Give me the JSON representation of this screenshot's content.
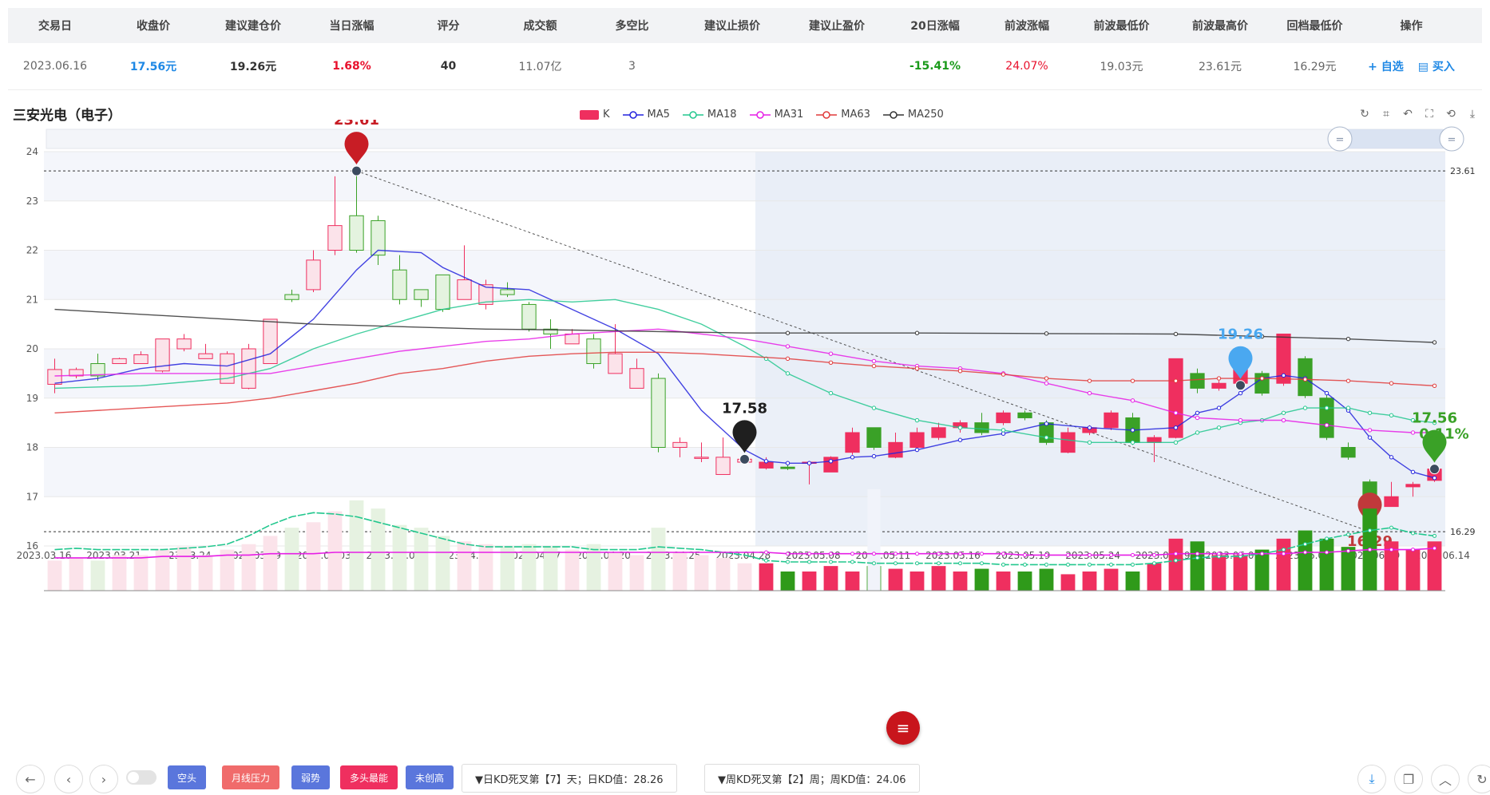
{
  "table": {
    "headers": [
      "交易日",
      "收盘价",
      "建议建仓价",
      "当日涨幅",
      "评分",
      "成交额",
      "多空比",
      "建议止损价",
      "建议止盈价",
      "20日涨幅",
      "前波涨幅",
      "前波最低价",
      "前波最高价",
      "回档最低价",
      "操作"
    ],
    "row": [
      "2023.06.16",
      "17.56元",
      "19.26元",
      "1.68%",
      "40",
      "11.07亿",
      "3",
      "",
      "",
      "-15.41%",
      "24.07%",
      "19.03元",
      "23.61元",
      "16.29元"
    ],
    "row_colors": [
      "#666",
      "#1e88e5",
      "#333",
      "#e8112d",
      "#333",
      "#666",
      "#666",
      "#333",
      "#333",
      "#1a9a1a",
      "#e8112d",
      "#666",
      "#666",
      "#666"
    ],
    "row_bold": [
      false,
      true,
      true,
      true,
      true,
      false,
      false,
      false,
      false,
      true,
      false,
      false,
      false,
      false
    ],
    "action_watch": "+ 自选",
    "action_buy": "买入"
  },
  "chart_title": "三安光电（电子）",
  "legend": [
    {
      "name": "K",
      "color": "#ef2f5f"
    },
    {
      "name": "MA5",
      "color": "#2222dd"
    },
    {
      "name": "MA18",
      "color": "#22c78e"
    },
    {
      "name": "MA31",
      "color": "#e61ee6"
    },
    {
      "name": "MA63",
      "color": "#e03a3a"
    },
    {
      "name": "MA250",
      "color": "#333333"
    }
  ],
  "tool_icons": [
    "refresh-icon",
    "crop-icon",
    "undo-crop-icon",
    "fullscreen-icon",
    "reset-icon",
    "download-icon"
  ],
  "chart_data": {
    "type": "candlestick",
    "ylim": [
      16,
      24
    ],
    "yticks": [
      16,
      17,
      18,
      19,
      20,
      21,
      22,
      23,
      24
    ],
    "xticks": [
      "2023.03.16",
      "2023.03.21",
      "2023.03.24",
      "2023.03.29",
      "2023.04.03",
      "2023.04.07",
      "2023.04.12",
      "2023.04.17",
      "2023.04.20",
      "2023.04.25",
      "2023.04.28",
      "2023.05.08",
      "2023.05.11",
      "2023.05.16",
      "2023.05.19",
      "2023.05.24",
      "2023.05.29",
      "2023.06.01",
      "2023.06.06",
      "2023.06.09",
      "2023.06.14"
    ],
    "candles": [
      [
        19.28,
        19.58,
        19.1,
        19.8
      ],
      [
        19.45,
        19.58,
        19.4,
        19.62
      ],
      [
        19.7,
        19.45,
        19.35,
        19.9
      ],
      [
        19.7,
        19.8,
        19.7,
        19.82
      ],
      [
        19.7,
        19.88,
        19.7,
        19.95
      ],
      [
        19.55,
        20.2,
        19.52,
        20.2
      ],
      [
        20.0,
        20.2,
        19.95,
        20.3
      ],
      [
        19.8,
        19.9,
        19.8,
        20.1
      ],
      [
        19.3,
        19.9,
        19.3,
        19.95
      ],
      [
        19.2,
        20.0,
        19.18,
        20.1
      ],
      [
        19.7,
        20.6,
        19.7,
        20.6
      ],
      [
        21.1,
        21.0,
        20.95,
        21.2
      ],
      [
        21.2,
        21.8,
        21.15,
        22.0
      ],
      [
        22.0,
        22.5,
        21.9,
        23.5
      ],
      [
        22.7,
        22.0,
        21.95,
        23.61
      ],
      [
        22.6,
        21.9,
        21.7,
        22.7
      ],
      [
        21.6,
        21.0,
        20.9,
        21.9
      ],
      [
        21.2,
        21.0,
        20.85,
        21.2
      ],
      [
        21.5,
        20.8,
        20.75,
        21.5
      ],
      [
        21.0,
        21.4,
        21.0,
        22.1
      ],
      [
        20.9,
        21.3,
        20.8,
        21.4
      ],
      [
        21.2,
        21.1,
        21.05,
        21.35
      ],
      [
        20.9,
        20.4,
        20.35,
        20.95
      ],
      [
        20.4,
        20.3,
        20.0,
        20.6
      ],
      [
        20.1,
        20.3,
        20.1,
        20.4
      ],
      [
        20.2,
        19.7,
        19.6,
        20.3
      ],
      [
        19.5,
        19.9,
        19.5,
        20.5
      ],
      [
        19.2,
        19.6,
        19.2,
        19.8
      ],
      [
        19.4,
        18.0,
        17.9,
        19.5
      ],
      [
        18.0,
        18.1,
        17.8,
        18.2
      ],
      [
        17.8,
        17.8,
        17.7,
        18.1
      ],
      [
        17.45,
        17.8,
        17.45,
        18.2
      ],
      [
        17.7,
        17.76,
        17.68,
        17.82
      ],
      [
        17.58,
        17.7,
        17.55,
        17.8
      ],
      [
        17.6,
        17.57,
        17.54,
        17.64
      ],
      [
        17.7,
        17.7,
        17.25,
        17.72
      ],
      [
        17.5,
        17.8,
        17.5,
        17.82
      ],
      [
        17.9,
        18.3,
        17.85,
        18.4
      ],
      [
        18.4,
        18.0,
        17.95,
        18.4
      ],
      [
        17.8,
        18.1,
        17.78,
        18.3
      ],
      [
        18.0,
        18.3,
        17.98,
        18.4
      ],
      [
        18.2,
        18.4,
        18.15,
        18.5
      ],
      [
        18.4,
        18.5,
        18.3,
        18.55
      ],
      [
        18.5,
        18.3,
        18.25,
        18.7
      ],
      [
        18.5,
        18.7,
        18.45,
        18.75
      ],
      [
        18.7,
        18.6,
        18.55,
        18.75
      ],
      [
        18.5,
        18.1,
        18.05,
        18.55
      ],
      [
        17.9,
        18.3,
        17.88,
        18.4
      ],
      [
        18.3,
        18.4,
        18.25,
        18.45
      ],
      [
        18.4,
        18.7,
        18.35,
        18.75
      ],
      [
        18.6,
        18.1,
        18.05,
        18.7
      ],
      [
        18.1,
        18.2,
        17.7,
        18.25
      ],
      [
        18.2,
        19.8,
        18.18,
        19.8
      ],
      [
        19.5,
        19.2,
        19.1,
        19.6
      ],
      [
        19.2,
        19.3,
        19.15,
        19.35
      ],
      [
        19.3,
        19.6,
        19.2,
        19.7
      ],
      [
        19.5,
        19.1,
        19.05,
        19.55
      ],
      [
        19.3,
        20.3,
        19.25,
        20.3
      ],
      [
        19.8,
        19.05,
        19.0,
        19.85
      ],
      [
        19.0,
        18.2,
        18.15,
        19.1
      ],
      [
        18.0,
        17.8,
        17.75,
        18.1
      ],
      [
        17.3,
        16.3,
        16.29,
        17.35
      ],
      [
        16.8,
        17.0,
        16.8,
        17.3
      ],
      [
        17.2,
        17.25,
        17.0,
        17.3
      ],
      [
        17.33,
        17.56,
        17.3,
        17.6
      ]
    ],
    "ma": {
      "MA5": [
        [
          0,
          19.3
        ],
        [
          2,
          19.4
        ],
        [
          4,
          19.6
        ],
        [
          6,
          19.7
        ],
        [
          8,
          19.65
        ],
        [
          10,
          19.9
        ],
        [
          12,
          20.6
        ],
        [
          14,
          21.6
        ],
        [
          15,
          22.0
        ],
        [
          17,
          21.95
        ],
        [
          18,
          21.65
        ],
        [
          20,
          21.25
        ],
        [
          22,
          21.2
        ],
        [
          24,
          20.8
        ],
        [
          26,
          20.4
        ],
        [
          28,
          19.9
        ],
        [
          30,
          18.75
        ],
        [
          32,
          17.95
        ],
        [
          33,
          17.72
        ],
        [
          34,
          17.68
        ],
        [
          35,
          17.68
        ],
        [
          36,
          17.72
        ],
        [
          37,
          17.8
        ],
        [
          38,
          17.82
        ],
        [
          40,
          17.95
        ],
        [
          42,
          18.15
        ],
        [
          44,
          18.28
        ],
        [
          46,
          18.48
        ],
        [
          48,
          18.4
        ],
        [
          50,
          18.35
        ],
        [
          52,
          18.4
        ],
        [
          53,
          18.7
        ],
        [
          54,
          18.8
        ],
        [
          55,
          19.1
        ],
        [
          56,
          19.4
        ],
        [
          57,
          19.46
        ],
        [
          58,
          19.4
        ],
        [
          59,
          19.1
        ],
        [
          60,
          18.75
        ],
        [
          61,
          18.2
        ],
        [
          62,
          17.8
        ],
        [
          63,
          17.5
        ],
        [
          64,
          17.38
        ]
      ],
      "MA18": [
        [
          0,
          19.2
        ],
        [
          4,
          19.25
        ],
        [
          8,
          19.4
        ],
        [
          10,
          19.6
        ],
        [
          12,
          20.0
        ],
        [
          14,
          20.3
        ],
        [
          16,
          20.55
        ],
        [
          18,
          20.8
        ],
        [
          20,
          20.95
        ],
        [
          22,
          21.0
        ],
        [
          24,
          20.95
        ],
        [
          26,
          21.0
        ],
        [
          28,
          20.8
        ],
        [
          30,
          20.5
        ],
        [
          32,
          20.05
        ],
        [
          33,
          19.8
        ],
        [
          34,
          19.5
        ],
        [
          36,
          19.1
        ],
        [
          38,
          18.8
        ],
        [
          40,
          18.55
        ],
        [
          42,
          18.4
        ],
        [
          44,
          18.35
        ],
        [
          46,
          18.2
        ],
        [
          48,
          18.1
        ],
        [
          50,
          18.1
        ],
        [
          52,
          18.1
        ],
        [
          53,
          18.3
        ],
        [
          54,
          18.4
        ],
        [
          55,
          18.5
        ],
        [
          56,
          18.55
        ],
        [
          57,
          18.7
        ],
        [
          58,
          18.8
        ],
        [
          59,
          18.8
        ],
        [
          60,
          18.8
        ],
        [
          61,
          18.7
        ],
        [
          62,
          18.65
        ],
        [
          63,
          18.55
        ],
        [
          64,
          18.5
        ]
      ],
      "MA31": [
        [
          0,
          19.45
        ],
        [
          4,
          19.5
        ],
        [
          8,
          19.5
        ],
        [
          10,
          19.5
        ],
        [
          12,
          19.65
        ],
        [
          14,
          19.8
        ],
        [
          16,
          19.95
        ],
        [
          18,
          20.05
        ],
        [
          20,
          20.15
        ],
        [
          22,
          20.2
        ],
        [
          24,
          20.3
        ],
        [
          26,
          20.35
        ],
        [
          28,
          20.4
        ],
        [
          30,
          20.3
        ],
        [
          32,
          20.2
        ],
        [
          34,
          20.05
        ],
        [
          36,
          19.9
        ],
        [
          38,
          19.75
        ],
        [
          40,
          19.65
        ],
        [
          42,
          19.6
        ],
        [
          44,
          19.5
        ],
        [
          46,
          19.3
        ],
        [
          48,
          19.1
        ],
        [
          50,
          18.95
        ],
        [
          52,
          18.7
        ],
        [
          53,
          18.6
        ],
        [
          55,
          18.55
        ],
        [
          57,
          18.55
        ],
        [
          59,
          18.45
        ],
        [
          61,
          18.35
        ],
        [
          63,
          18.3
        ],
        [
          64,
          18.3
        ]
      ],
      "MA63": [
        [
          0,
          18.7
        ],
        [
          4,
          18.8
        ],
        [
          8,
          18.9
        ],
        [
          10,
          19.0
        ],
        [
          12,
          19.15
        ],
        [
          14,
          19.3
        ],
        [
          16,
          19.5
        ],
        [
          18,
          19.6
        ],
        [
          20,
          19.75
        ],
        [
          22,
          19.85
        ],
        [
          24,
          19.9
        ],
        [
          26,
          19.93
        ],
        [
          28,
          19.93
        ],
        [
          30,
          19.9
        ],
        [
          32,
          19.85
        ],
        [
          34,
          19.8
        ],
        [
          36,
          19.72
        ],
        [
          38,
          19.65
        ],
        [
          40,
          19.6
        ],
        [
          42,
          19.55
        ],
        [
          44,
          19.48
        ],
        [
          46,
          19.4
        ],
        [
          48,
          19.35
        ],
        [
          50,
          19.35
        ],
        [
          52,
          19.35
        ],
        [
          54,
          19.4
        ],
        [
          56,
          19.4
        ],
        [
          58,
          19.38
        ],
        [
          60,
          19.35
        ],
        [
          62,
          19.3
        ],
        [
          64,
          19.25
        ]
      ],
      "MA250": [
        [
          0,
          20.8
        ],
        [
          4,
          20.7
        ],
        [
          8,
          20.6
        ],
        [
          12,
          20.5
        ],
        [
          16,
          20.45
        ],
        [
          20,
          20.4
        ],
        [
          24,
          20.38
        ],
        [
          28,
          20.35
        ],
        [
          32,
          20.32
        ],
        [
          34,
          20.32
        ],
        [
          40,
          20.32
        ],
        [
          46,
          20.31
        ],
        [
          52,
          20.3
        ],
        [
          56,
          20.25
        ],
        [
          60,
          20.2
        ],
        [
          64,
          20.13
        ]
      ]
    },
    "annotations": [
      {
        "label": "23.61",
        "index": 14,
        "value": 23.61,
        "color": "#c81d25",
        "type": "pin"
      },
      {
        "label": "17.58",
        "index": 32,
        "value": 17.76,
        "color": "#1f1f1f",
        "type": "pin"
      },
      {
        "label": "19.26",
        "index": 55,
        "value": 19.26,
        "color": "#4aa8f0",
        "type": "pin"
      },
      {
        "label": "16.29",
        "index": 61,
        "value": 16.29,
        "color": "#c0393b",
        "type": "pin-low"
      },
      {
        "label": "17.56",
        "index": 64,
        "value": 17.56,
        "color": "#3aa127",
        "type": "pin"
      },
      {
        "label": "0.11%",
        "index": 64,
        "value": 17.56,
        "color": "#3aa127",
        "type": "sub"
      }
    ],
    "hlines": [
      23.61,
      16.29
    ],
    "hline_labels": [
      "23.61",
      "16.29"
    ],
    "shade_from_index": 33,
    "volume": [
      22,
      24,
      22,
      26,
      26,
      30,
      32,
      26,
      30,
      34,
      40,
      46,
      50,
      58,
      66,
      60,
      48,
      46,
      40,
      36,
      34,
      32,
      34,
      32,
      30,
      34,
      28,
      26,
      46,
      28,
      26,
      24,
      20,
      20,
      14,
      14,
      18,
      14,
      18,
      16,
      14,
      18,
      14,
      16,
      14,
      14,
      16,
      12,
      14,
      16,
      14,
      20,
      38,
      36,
      26,
      26,
      30,
      38,
      44,
      38,
      32,
      60,
      36,
      30,
      36
    ],
    "volume_ma_a": [
      30,
      31,
      30,
      30,
      30,
      30,
      31,
      32,
      34,
      40,
      48,
      54,
      57,
      56,
      54,
      50,
      46,
      42,
      38,
      34,
      32,
      32,
      32,
      32,
      32,
      30,
      30,
      30,
      32,
      31,
      30,
      28,
      26,
      22,
      21,
      21,
      21,
      21,
      20,
      20,
      20,
      20,
      20,
      20,
      19,
      19,
      19,
      19,
      19,
      19,
      19,
      20,
      22,
      24,
      25,
      25,
      27,
      30,
      34,
      38,
      41,
      44,
      46,
      42,
      40
    ],
    "volume_ma_b": [
      24,
      24,
      24,
      24,
      24,
      25,
      25,
      25,
      26,
      26,
      27,
      27,
      27,
      28,
      28,
      28,
      28,
      28,
      28,
      28,
      28,
      28,
      28,
      28,
      28,
      28,
      28,
      28,
      28,
      28,
      28,
      28,
      28,
      28,
      27,
      27,
      27,
      27,
      27,
      27,
      27,
      27,
      27,
      27,
      27,
      26,
      26,
      26,
      26,
      26,
      26,
      26,
      27,
      27,
      27,
      27,
      27,
      27,
      28,
      28,
      29,
      30,
      30,
      30,
      31
    ]
  },
  "bottom": {
    "tags": [
      {
        "label": "空头",
        "color": "#5a76dc"
      },
      {
        "label": "月线压力",
        "color": "#f06b6b"
      },
      {
        "label": "弱势",
        "color": "#5a76dc"
      },
      {
        "label": "多头最能",
        "color": "#ef2f5f"
      },
      {
        "label": "未创高",
        "color": "#5a76dc"
      }
    ],
    "kd_daily": "▼日KD死叉第【7】天；日KD值：28.26",
    "kd_weekly": "▼周KD死叉第【2】周；周KD值：24.06"
  }
}
